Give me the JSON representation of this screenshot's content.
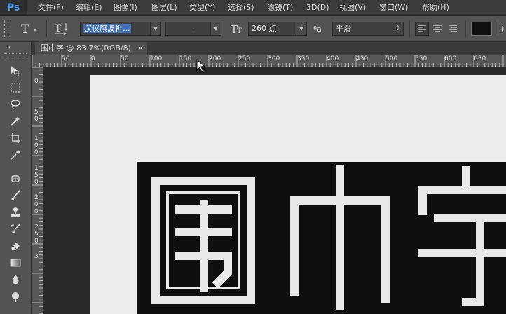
{
  "app": {
    "logo": "Ps"
  },
  "menu": [
    "文件(F)",
    "编辑(E)",
    "图像(I)",
    "图层(L)",
    "类型(Y)",
    "选择(S)",
    "滤镜(T)",
    "3D(D)",
    "视图(V)",
    "窗口(W)",
    "帮助(H)"
  ],
  "options": {
    "tool_icon": "text-tool-icon",
    "font_family": "汉仪旗波折...",
    "font_style": "-",
    "font_size": "260 点",
    "aa_label": "ªa",
    "antialias": "平滑",
    "text_color": "#111111"
  },
  "document": {
    "tab_title": "围巾字 @ 83.7%(RGB/8)",
    "close_glyph": "×"
  },
  "ruler": {
    "top": [
      "50",
      "0",
      "50",
      "100",
      "150",
      "200",
      "250",
      "300",
      "350",
      "400",
      "450",
      "500",
      "550",
      "600",
      "650"
    ],
    "left": [
      "0",
      "5",
      "0",
      "1",
      "0",
      "0",
      "1",
      "5",
      "0",
      "2",
      "0",
      "0",
      "2",
      "5",
      "0",
      "3"
    ]
  },
  "canvas": {
    "text": "围巾字",
    "text_color": "#e8e8e8",
    "background": "#0f0f0f",
    "page": "#ececec"
  }
}
